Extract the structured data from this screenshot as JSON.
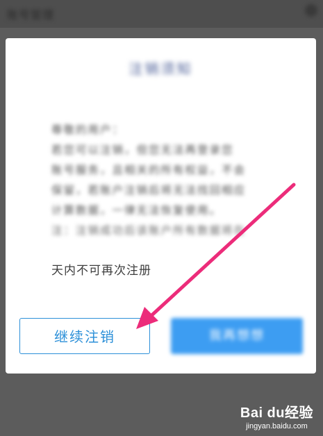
{
  "topbar": {
    "title": "账号管理"
  },
  "dialog": {
    "title": "注销须知",
    "body_lines": [
      "尊敬的用户：",
      "若您可以注销，但您无法再登录您",
      "账号服务，且相关的所有权益，不会",
      "保留，若账户注销后将无法找回相应",
      "计算数据，一律无法恢复使用。"
    ],
    "warning_prefix": "注：注销成功后该账户所有数据将在",
    "warning_suffix": "天内不可再次注册",
    "continue_label": "继续注销",
    "cancel_label": "我再想想"
  },
  "watermark": {
    "logo": "Bai du经验",
    "url": "jingyan.baidu.com"
  },
  "colors": {
    "accent": "#2b8fd8",
    "arrow": "#ec2c7a",
    "overlay": "#5c5c5c"
  }
}
